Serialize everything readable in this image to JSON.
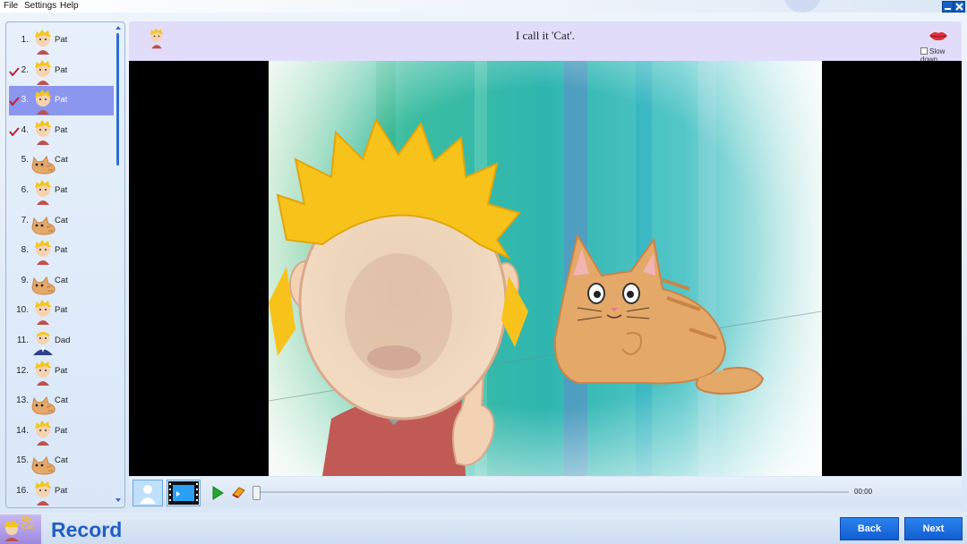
{
  "menu": {
    "file": "File",
    "settings": "Settings",
    "help": "Help"
  },
  "sidebar": {
    "items": [
      {
        "num": "1.",
        "name": "Pat",
        "char": "pat",
        "checked": false,
        "selected": false
      },
      {
        "num": "2.",
        "name": "Pat",
        "char": "pat",
        "checked": true,
        "selected": false
      },
      {
        "num": "3.",
        "name": "Pat",
        "char": "pat",
        "checked": true,
        "selected": true
      },
      {
        "num": "4.",
        "name": "Pat",
        "char": "pat",
        "checked": true,
        "selected": false
      },
      {
        "num": "5.",
        "name": "Cat",
        "char": "cat",
        "checked": false,
        "selected": false
      },
      {
        "num": "6.",
        "name": "Pat",
        "char": "pat",
        "checked": false,
        "selected": false
      },
      {
        "num": "7.",
        "name": "Cat",
        "char": "cat",
        "checked": false,
        "selected": false
      },
      {
        "num": "8.",
        "name": "Pat",
        "char": "pat",
        "checked": false,
        "selected": false
      },
      {
        "num": "9.",
        "name": "Cat",
        "char": "cat",
        "checked": false,
        "selected": false
      },
      {
        "num": "10.",
        "name": "Pat",
        "char": "pat",
        "checked": false,
        "selected": false
      },
      {
        "num": "11.",
        "name": "Dad",
        "char": "dad",
        "checked": false,
        "selected": false
      },
      {
        "num": "12.",
        "name": "Pat",
        "char": "pat",
        "checked": false,
        "selected": false
      },
      {
        "num": "13.",
        "name": "Cat",
        "char": "cat",
        "checked": false,
        "selected": false
      },
      {
        "num": "14.",
        "name": "Pat",
        "char": "pat",
        "checked": false,
        "selected": false
      },
      {
        "num": "15.",
        "name": "Cat",
        "char": "cat",
        "checked": false,
        "selected": false
      },
      {
        "num": "16.",
        "name": "Pat",
        "char": "pat",
        "checked": false,
        "selected": false
      }
    ]
  },
  "header": {
    "subtitle": "I call it 'Cat'.",
    "slow_down": "Slow down",
    "mouth_icon": "lips-icon"
  },
  "player": {
    "time": "00:00",
    "progress": 0
  },
  "footer": {
    "logo_text": "My Cat",
    "title": "Record",
    "back": "Back",
    "next": "Next"
  },
  "colors": {
    "accent": "#1f5fc4",
    "selected_row": "#8b96ee",
    "header_bg": "#e2dcfb",
    "button": "#1a6fe0"
  }
}
